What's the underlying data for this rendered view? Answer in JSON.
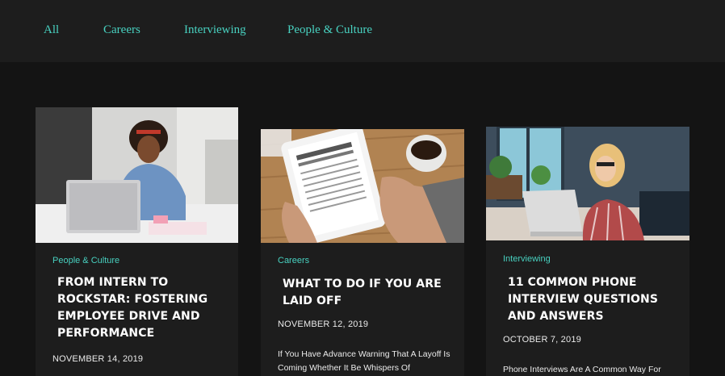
{
  "nav": {
    "items": [
      {
        "label": "All"
      },
      {
        "label": "Careers"
      },
      {
        "label": "Interviewing"
      },
      {
        "label": "People & Culture"
      }
    ]
  },
  "posts": [
    {
      "category": "People & Culture",
      "title": "From Intern to Rockstar: Fostering Employee Drive and Performance",
      "date": "NOVEMBER 14, 2019",
      "excerpt": ""
    },
    {
      "category": "Careers",
      "title": "What to Do If You Are Laid Off",
      "date": "NOVEMBER 12, 2019",
      "excerpt": "If You Have Advance Warning That A Layoff Is Coming Whether It Be Whispers Of"
    },
    {
      "category": "Interviewing",
      "title": "11 Common Phone Interview Questions and Answers",
      "date": "OCTOBER 7, 2019",
      "excerpt": "Phone Interviews Are A Common Way For"
    }
  ],
  "images": {
    "post_0": "woman-laptop-photo",
    "post_1": "termination-form-tablet-photo",
    "post_2": "woman-phone-laptop-photo"
  },
  "colors": {
    "accent": "#48d1c0",
    "page_bg": "#141414",
    "card_bg": "#1d1d1d"
  }
}
